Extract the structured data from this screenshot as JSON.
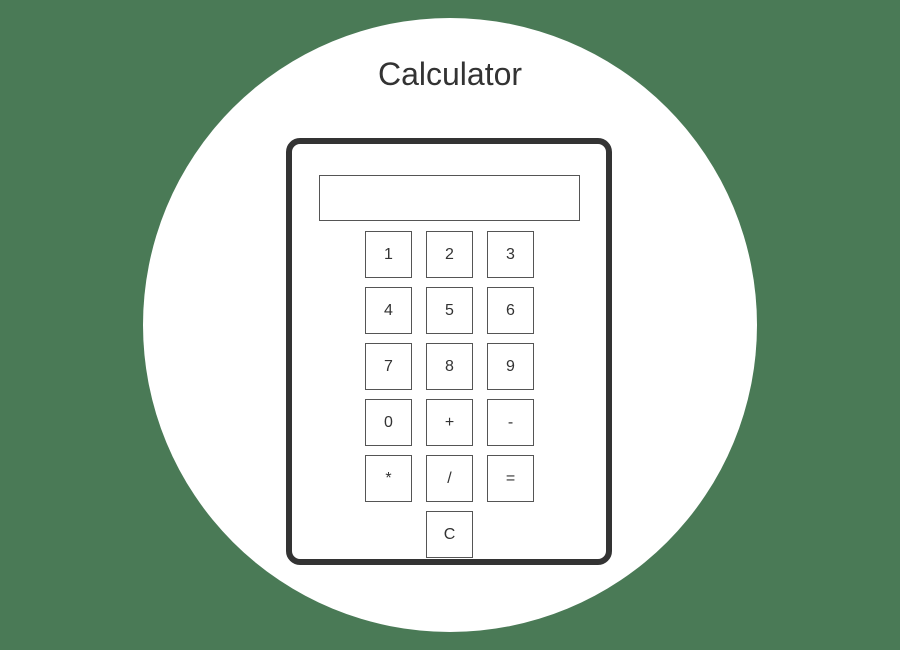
{
  "title": "Calculator",
  "display": {
    "value": ""
  },
  "keys": {
    "k1": "1",
    "k2": "2",
    "k3": "3",
    "k4": "4",
    "k5": "5",
    "k6": "6",
    "k7": "7",
    "k8": "8",
    "k9": "9",
    "k0": "0",
    "plus": "+",
    "minus": "-",
    "multiply": "*",
    "divide": "/",
    "equals": "=",
    "clear": "C"
  },
  "colors": {
    "background": "#4a7a56",
    "circle": "#ffffff",
    "frame": "#333333",
    "key_border": "#555555",
    "text": "#333333"
  }
}
